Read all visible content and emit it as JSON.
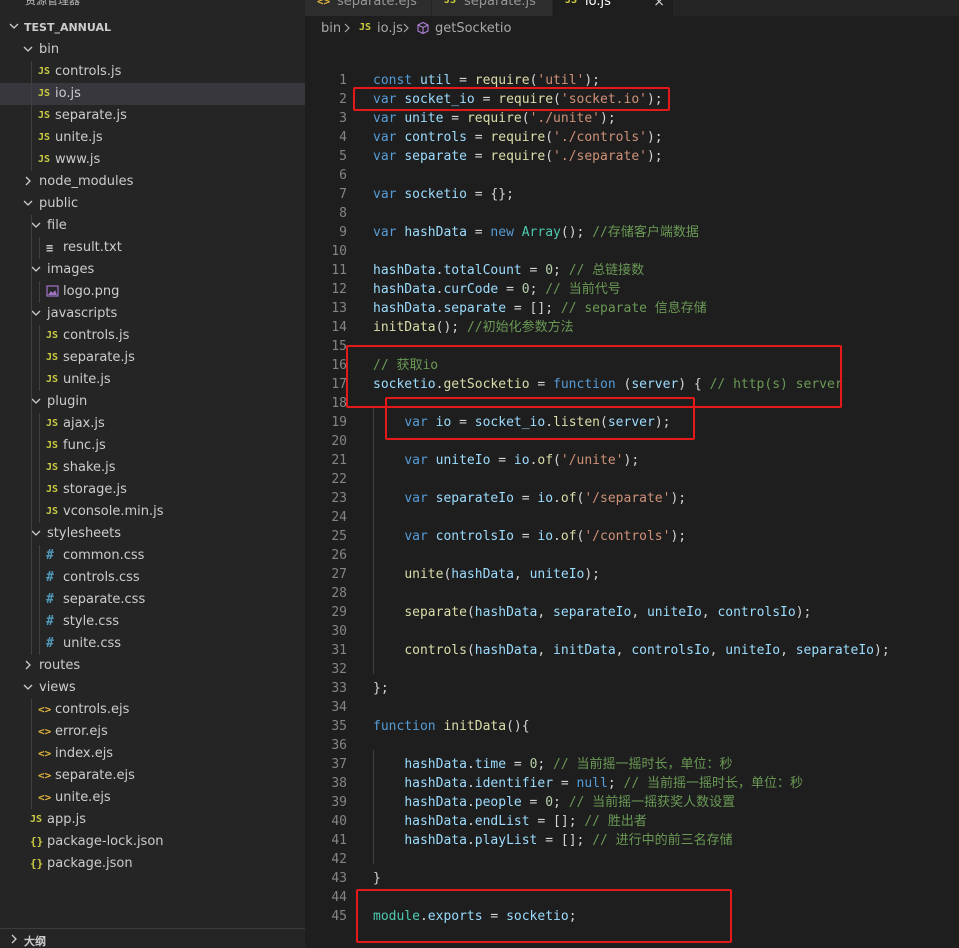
{
  "explorer": {
    "title": "资源管理器",
    "project": "TEST_ANNUAL",
    "outline": "大纲",
    "items": [
      {
        "label": "bin",
        "type": "folder",
        "open": true,
        "depth": 1
      },
      {
        "label": "controls.js",
        "type": "js",
        "depth": 2
      },
      {
        "label": "io.js",
        "type": "js",
        "depth": 2,
        "active": true
      },
      {
        "label": "separate.js",
        "type": "js",
        "depth": 2
      },
      {
        "label": "unite.js",
        "type": "js",
        "depth": 2
      },
      {
        "label": "www.js",
        "type": "js",
        "depth": 2
      },
      {
        "label": "node_modules",
        "type": "folder",
        "open": false,
        "depth": 1
      },
      {
        "label": "public",
        "type": "folder",
        "open": true,
        "depth": 1
      },
      {
        "label": "file",
        "type": "folder",
        "open": true,
        "depth": 2
      },
      {
        "label": "result.txt",
        "type": "txt",
        "depth": 3
      },
      {
        "label": "images",
        "type": "folder",
        "open": true,
        "depth": 2
      },
      {
        "label": "logo.png",
        "type": "png",
        "depth": 3
      },
      {
        "label": "javascripts",
        "type": "folder",
        "open": true,
        "depth": 2
      },
      {
        "label": "controls.js",
        "type": "js",
        "depth": 3
      },
      {
        "label": "separate.js",
        "type": "js",
        "depth": 3
      },
      {
        "label": "unite.js",
        "type": "js",
        "depth": 3
      },
      {
        "label": "plugin",
        "type": "folder",
        "open": true,
        "depth": 2
      },
      {
        "label": "ajax.js",
        "type": "js",
        "depth": 3
      },
      {
        "label": "func.js",
        "type": "js",
        "depth": 3
      },
      {
        "label": "shake.js",
        "type": "js",
        "depth": 3
      },
      {
        "label": "storage.js",
        "type": "js",
        "depth": 3
      },
      {
        "label": "vconsole.min.js",
        "type": "js",
        "depth": 3
      },
      {
        "label": "stylesheets",
        "type": "folder",
        "open": true,
        "depth": 2
      },
      {
        "label": "common.css",
        "type": "css",
        "depth": 3
      },
      {
        "label": "controls.css",
        "type": "css",
        "depth": 3
      },
      {
        "label": "separate.css",
        "type": "css",
        "depth": 3
      },
      {
        "label": "style.css",
        "type": "css",
        "depth": 3
      },
      {
        "label": "unite.css",
        "type": "css",
        "depth": 3
      },
      {
        "label": "routes",
        "type": "folder",
        "open": false,
        "depth": 1
      },
      {
        "label": "views",
        "type": "folder",
        "open": true,
        "depth": 1
      },
      {
        "label": "controls.ejs",
        "type": "ejs",
        "depth": 2
      },
      {
        "label": "error.ejs",
        "type": "ejs",
        "depth": 2
      },
      {
        "label": "index.ejs",
        "type": "ejs",
        "depth": 2
      },
      {
        "label": "separate.ejs",
        "type": "ejs",
        "depth": 2
      },
      {
        "label": "unite.ejs",
        "type": "ejs",
        "depth": 2
      },
      {
        "label": "app.js",
        "type": "js",
        "depth": 1
      },
      {
        "label": "package-lock.json",
        "type": "json",
        "depth": 1
      },
      {
        "label": "package.json",
        "type": "json",
        "depth": 1
      }
    ]
  },
  "tabs": [
    {
      "label": "separate.ejs",
      "icon": "ejs",
      "active": false
    },
    {
      "label": "separate.js",
      "icon": "js",
      "active": false
    },
    {
      "label": "io.js",
      "icon": "js",
      "active": true
    }
  ],
  "icons": {
    "js": "JS",
    "css": "#",
    "ejs": "<>",
    "json": "{}",
    "txt": "≡",
    "close": "×",
    "chevron_open": "v",
    "chevron_closed": ">"
  },
  "breadcrumb": [
    "bin",
    "io.js",
    "getSocketio"
  ],
  "code_lines": [
    [
      {
        "t": "const ",
        "c": "kw"
      },
      {
        "t": "util",
        "c": "var"
      },
      {
        "t": " = "
      },
      {
        "t": "require",
        "c": "fn"
      },
      {
        "t": "("
      },
      {
        "t": "'util'",
        "c": "str"
      },
      {
        "t": ");"
      }
    ],
    [
      {
        "t": "var ",
        "c": "kw"
      },
      {
        "t": "socket_io",
        "c": "var"
      },
      {
        "t": " = "
      },
      {
        "t": "require",
        "c": "fn"
      },
      {
        "t": "("
      },
      {
        "t": "'socket.io'",
        "c": "str"
      },
      {
        "t": ");"
      }
    ],
    [
      {
        "t": "var ",
        "c": "kw"
      },
      {
        "t": "unite",
        "c": "var"
      },
      {
        "t": " = "
      },
      {
        "t": "require",
        "c": "fn"
      },
      {
        "t": "("
      },
      {
        "t": "'./unite'",
        "c": "str"
      },
      {
        "t": ");"
      }
    ],
    [
      {
        "t": "var ",
        "c": "kw"
      },
      {
        "t": "controls",
        "c": "var"
      },
      {
        "t": " = "
      },
      {
        "t": "require",
        "c": "fn"
      },
      {
        "t": "("
      },
      {
        "t": "'./controls'",
        "c": "str"
      },
      {
        "t": ");"
      }
    ],
    [
      {
        "t": "var ",
        "c": "kw"
      },
      {
        "t": "separate",
        "c": "var"
      },
      {
        "t": " = "
      },
      {
        "t": "require",
        "c": "fn"
      },
      {
        "t": "("
      },
      {
        "t": "'./separate'",
        "c": "str"
      },
      {
        "t": ");"
      }
    ],
    [],
    [
      {
        "t": "var ",
        "c": "kw"
      },
      {
        "t": "socketio",
        "c": "var"
      },
      {
        "t": " = {};"
      }
    ],
    [],
    [
      {
        "t": "var ",
        "c": "kw"
      },
      {
        "t": "hashData",
        "c": "var"
      },
      {
        "t": " = "
      },
      {
        "t": "new ",
        "c": "kw"
      },
      {
        "t": "Array",
        "c": "cls"
      },
      {
        "t": "(); "
      },
      {
        "t": "//存储客户端数据",
        "c": "cmt"
      }
    ],
    [],
    [
      {
        "t": "hashData",
        "c": "var"
      },
      {
        "t": "."
      },
      {
        "t": "totalCount",
        "c": "var"
      },
      {
        "t": " = "
      },
      {
        "t": "0",
        "c": "num"
      },
      {
        "t": "; "
      },
      {
        "t": "// 总链接数",
        "c": "cmt"
      }
    ],
    [
      {
        "t": "hashData",
        "c": "var"
      },
      {
        "t": "."
      },
      {
        "t": "curCode",
        "c": "var"
      },
      {
        "t": " = "
      },
      {
        "t": "0",
        "c": "num"
      },
      {
        "t": "; "
      },
      {
        "t": "// 当前代号",
        "c": "cmt"
      }
    ],
    [
      {
        "t": "hashData",
        "c": "var"
      },
      {
        "t": "."
      },
      {
        "t": "separate",
        "c": "var"
      },
      {
        "t": " = []; "
      },
      {
        "t": "// separate 信息存储",
        "c": "cmt"
      }
    ],
    [
      {
        "t": "initData",
        "c": "fn"
      },
      {
        "t": "(); "
      },
      {
        "t": "//初始化参数方法",
        "c": "cmt"
      }
    ],
    [],
    [
      {
        "t": "// 获取io",
        "c": "cmt"
      }
    ],
    [
      {
        "t": "socketio",
        "c": "var"
      },
      {
        "t": "."
      },
      {
        "t": "getSocketio",
        "c": "fn"
      },
      {
        "t": " = "
      },
      {
        "t": "function ",
        "c": "kw"
      },
      {
        "t": "("
      },
      {
        "t": "server",
        "c": "var"
      },
      {
        "t": ") { "
      },
      {
        "t": "// http(s) server",
        "c": "cmt"
      }
    ],
    [],
    [
      {
        "t": "    "
      },
      {
        "t": "var ",
        "c": "kw"
      },
      {
        "t": "io",
        "c": "var"
      },
      {
        "t": " = "
      },
      {
        "t": "socket_io",
        "c": "var"
      },
      {
        "t": "."
      },
      {
        "t": "listen",
        "c": "fn"
      },
      {
        "t": "("
      },
      {
        "t": "server",
        "c": "var"
      },
      {
        "t": ");"
      }
    ],
    [],
    [
      {
        "t": "    "
      },
      {
        "t": "var ",
        "c": "kw"
      },
      {
        "t": "uniteIo",
        "c": "var"
      },
      {
        "t": " = "
      },
      {
        "t": "io",
        "c": "var"
      },
      {
        "t": "."
      },
      {
        "t": "of",
        "c": "fn"
      },
      {
        "t": "("
      },
      {
        "t": "'/unite'",
        "c": "str"
      },
      {
        "t": ");"
      }
    ],
    [],
    [
      {
        "t": "    "
      },
      {
        "t": "var ",
        "c": "kw"
      },
      {
        "t": "separateIo",
        "c": "var"
      },
      {
        "t": " = "
      },
      {
        "t": "io",
        "c": "var"
      },
      {
        "t": "."
      },
      {
        "t": "of",
        "c": "fn"
      },
      {
        "t": "("
      },
      {
        "t": "'/separate'",
        "c": "str"
      },
      {
        "t": ");"
      }
    ],
    [],
    [
      {
        "t": "    "
      },
      {
        "t": "var ",
        "c": "kw"
      },
      {
        "t": "controlsIo",
        "c": "var"
      },
      {
        "t": " = "
      },
      {
        "t": "io",
        "c": "var"
      },
      {
        "t": "."
      },
      {
        "t": "of",
        "c": "fn"
      },
      {
        "t": "("
      },
      {
        "t": "'/controls'",
        "c": "str"
      },
      {
        "t": ");"
      }
    ],
    [],
    [
      {
        "t": "    "
      },
      {
        "t": "unite",
        "c": "fn"
      },
      {
        "t": "("
      },
      {
        "t": "hashData",
        "c": "var"
      },
      {
        "t": ", "
      },
      {
        "t": "uniteIo",
        "c": "var"
      },
      {
        "t": ");"
      }
    ],
    [],
    [
      {
        "t": "    "
      },
      {
        "t": "separate",
        "c": "fn"
      },
      {
        "t": "("
      },
      {
        "t": "hashData",
        "c": "var"
      },
      {
        "t": ", "
      },
      {
        "t": "separateIo",
        "c": "var"
      },
      {
        "t": ", "
      },
      {
        "t": "uniteIo",
        "c": "var"
      },
      {
        "t": ", "
      },
      {
        "t": "controlsIo",
        "c": "var"
      },
      {
        "t": ");"
      }
    ],
    [],
    [
      {
        "t": "    "
      },
      {
        "t": "controls",
        "c": "fn"
      },
      {
        "t": "("
      },
      {
        "t": "hashData",
        "c": "var"
      },
      {
        "t": ", "
      },
      {
        "t": "initData",
        "c": "var"
      },
      {
        "t": ", "
      },
      {
        "t": "controlsIo",
        "c": "var"
      },
      {
        "t": ", "
      },
      {
        "t": "uniteIo",
        "c": "var"
      },
      {
        "t": ", "
      },
      {
        "t": "separateIo",
        "c": "var"
      },
      {
        "t": ");"
      }
    ],
    [],
    [
      {
        "t": "};"
      }
    ],
    [],
    [
      {
        "t": "function ",
        "c": "kw"
      },
      {
        "t": "initData",
        "c": "fn"
      },
      {
        "t": "(){"
      }
    ],
    [],
    [
      {
        "t": "    "
      },
      {
        "t": "hashData",
        "c": "var"
      },
      {
        "t": "."
      },
      {
        "t": "time",
        "c": "var"
      },
      {
        "t": " = "
      },
      {
        "t": "0",
        "c": "num"
      },
      {
        "t": "; "
      },
      {
        "t": "// 当前摇一摇时长，单位：秒",
        "c": "cmt"
      }
    ],
    [
      {
        "t": "    "
      },
      {
        "t": "hashData",
        "c": "var"
      },
      {
        "t": "."
      },
      {
        "t": "identifier",
        "c": "var"
      },
      {
        "t": " = "
      },
      {
        "t": "null",
        "c": "kw"
      },
      {
        "t": "; "
      },
      {
        "t": "// 当前摇一摇时长，单位：秒",
        "c": "cmt"
      }
    ],
    [
      {
        "t": "    "
      },
      {
        "t": "hashData",
        "c": "var"
      },
      {
        "t": "."
      },
      {
        "t": "people",
        "c": "var"
      },
      {
        "t": " = "
      },
      {
        "t": "0",
        "c": "num"
      },
      {
        "t": "; "
      },
      {
        "t": "// 当前摇一摇获奖人数设置",
        "c": "cmt"
      }
    ],
    [
      {
        "t": "    "
      },
      {
        "t": "hashData",
        "c": "var"
      },
      {
        "t": "."
      },
      {
        "t": "endList",
        "c": "var"
      },
      {
        "t": " = []; "
      },
      {
        "t": "// 胜出者",
        "c": "cmt"
      }
    ],
    [
      {
        "t": "    "
      },
      {
        "t": "hashData",
        "c": "var"
      },
      {
        "t": "."
      },
      {
        "t": "playList",
        "c": "var"
      },
      {
        "t": " = []; "
      },
      {
        "t": "// 进行中的前三名存储",
        "c": "cmt"
      }
    ],
    [],
    [
      {
        "t": "}"
      }
    ],
    [],
    [
      {
        "t": "module",
        "c": "cls"
      },
      {
        "t": "."
      },
      {
        "t": "exports",
        "c": "var"
      },
      {
        "t": " = "
      },
      {
        "t": "socketio",
        "c": "var"
      },
      {
        "t": ";"
      }
    ]
  ]
}
